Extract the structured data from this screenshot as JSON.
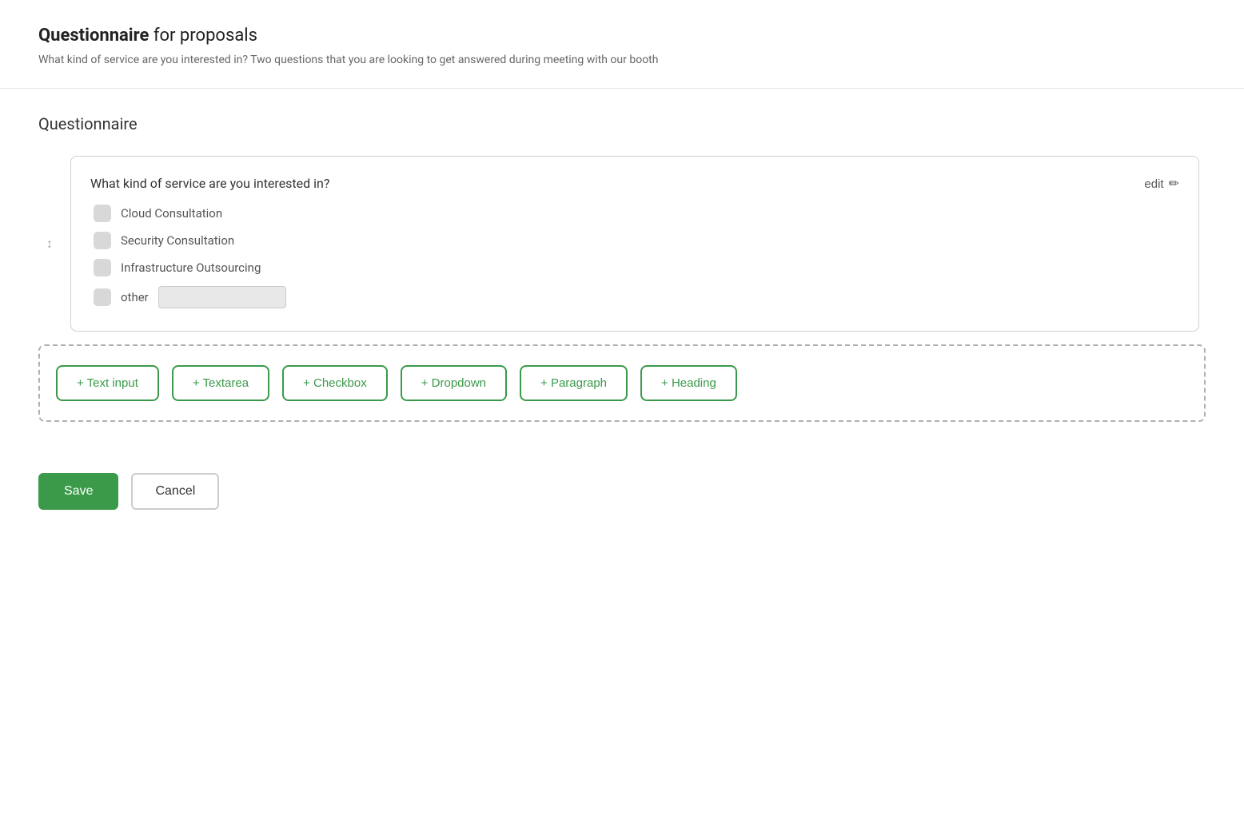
{
  "header": {
    "title_bold": "Questionnaire",
    "title_rest": " for proposals",
    "subtitle": "What kind of service are you interested in? Two questions that you are looking to get answered during meeting with our booth"
  },
  "section": {
    "title": "Questionnaire"
  },
  "question_card": {
    "question": "What kind of service are you interested in?",
    "edit_label": "edit",
    "options": [
      {
        "label": "Cloud Consultation"
      },
      {
        "label": "Security Consultation"
      },
      {
        "label": "Infrastructure Outsourcing"
      },
      {
        "label": "other"
      }
    ],
    "other_placeholder": ""
  },
  "add_buttons": [
    {
      "label": "+ Text input"
    },
    {
      "label": "+ Textarea"
    },
    {
      "label": "+ Checkbox"
    },
    {
      "label": "+ Dropdown"
    },
    {
      "label": "+ Paragraph"
    },
    {
      "label": "+ Heading"
    }
  ],
  "actions": {
    "save_label": "Save",
    "cancel_label": "Cancel"
  },
  "icons": {
    "sort": "↕",
    "pencil": "✏"
  }
}
